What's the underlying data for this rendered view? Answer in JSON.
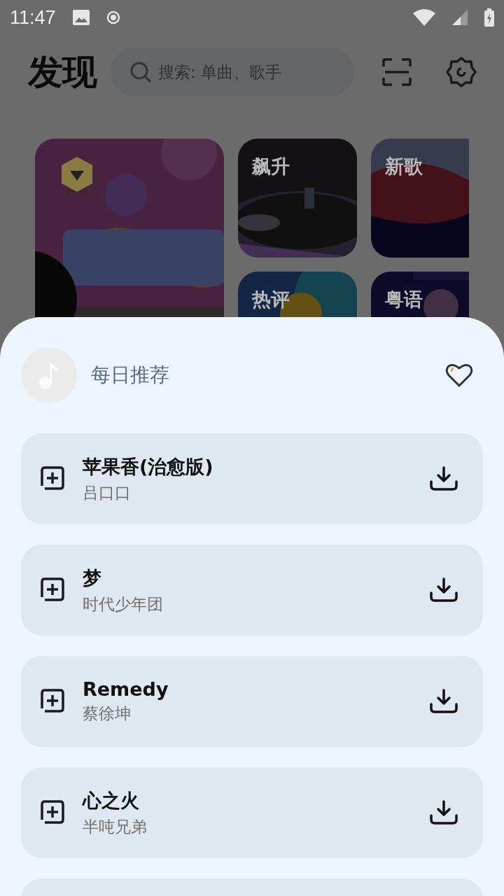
{
  "status_bar": {
    "time": "11:47"
  },
  "header": {
    "title": "发现",
    "search": {
      "placeholder": "搜索: 单曲、歌手"
    }
  },
  "tiles": [
    {
      "label": "飙升"
    },
    {
      "label": "新歌"
    },
    {
      "label": "热评"
    },
    {
      "label": "粤语"
    }
  ],
  "sheet": {
    "title": "每日推荐",
    "songs": [
      {
        "title": "苹果香(治愈版)",
        "artist": "吕口口"
      },
      {
        "title": "梦",
        "artist": "时代少年团"
      },
      {
        "title": "Remedy",
        "artist": "蔡徐坤"
      },
      {
        "title": "心之火",
        "artist": "半吨兄弟"
      }
    ]
  }
}
